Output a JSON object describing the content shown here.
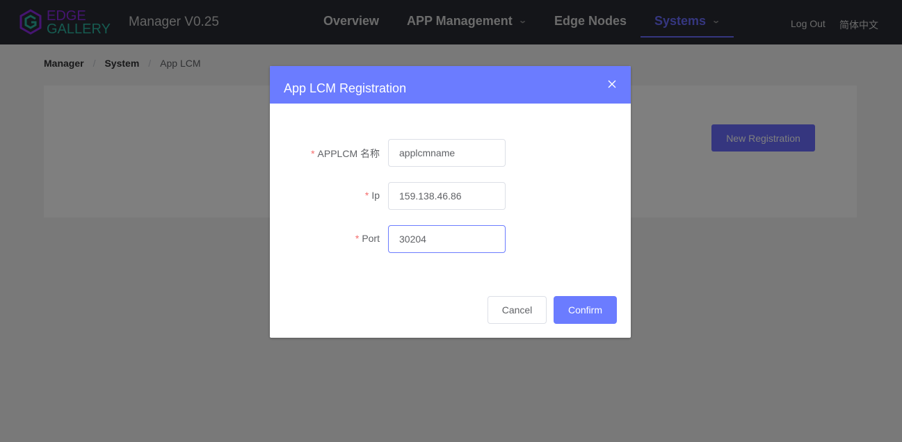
{
  "header": {
    "logo_line1": "EDGE",
    "logo_line2": "GALLERY",
    "app_title": "Manager V0.25",
    "nav": [
      {
        "label": "Overview"
      },
      {
        "label": "APP Management"
      },
      {
        "label": "Edge Nodes"
      },
      {
        "label": "Systems"
      }
    ],
    "active_nav": "Systems",
    "logout_label": "Log Out",
    "language_label": "简体中文"
  },
  "breadcrumb": {
    "items": [
      "Manager",
      "System",
      "App LCM"
    ],
    "separator": "/"
  },
  "main": {
    "new_registration_label": "New Registration"
  },
  "dialog": {
    "title": "App LCM Registration",
    "fields": [
      {
        "label": "APPLCM 名称",
        "value": "applcmname",
        "required": true
      },
      {
        "label": "Ip",
        "value": "159.138.46.86",
        "required": true
      },
      {
        "label": "Port",
        "value": "30204",
        "required": true,
        "focused": true
      }
    ],
    "required_mark": "*",
    "cancel_label": "Cancel",
    "confirm_label": "Confirm"
  },
  "colors": {
    "header_bg": "#282b33",
    "accent": "#6b6dff",
    "dialog_header": "#6b7cff",
    "required": "#f56c6c",
    "logo_edge": "#8a2be2",
    "logo_gallery": "#2cb5a0"
  },
  "icons": {
    "logo": "edgegallery-cube-logo",
    "close": "close-icon",
    "dropdown": "chevron-down-icon"
  }
}
